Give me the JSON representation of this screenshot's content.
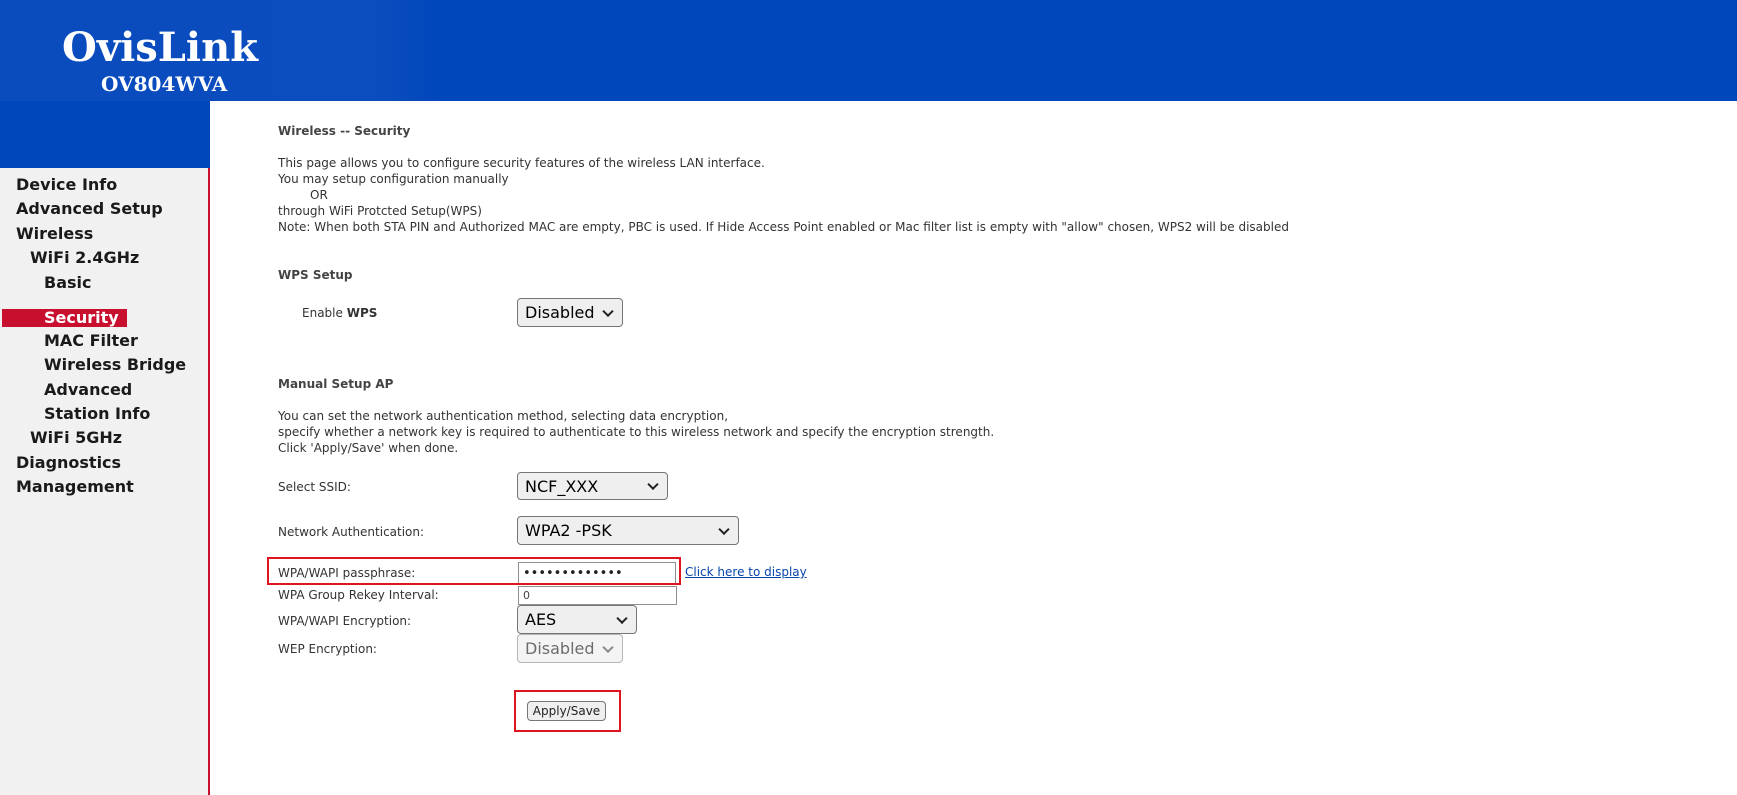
{
  "header": {
    "brand": "OvisLink",
    "model": "OV804WVA"
  },
  "colors": {
    "header_blue": "#0047bb",
    "active_red": "#c8102e",
    "highlight_red": "#e0141e",
    "link_blue": "#0645ad"
  },
  "sidebar": {
    "items": [
      {
        "label": "Device Info",
        "level": 0
      },
      {
        "label": "Advanced Setup",
        "level": 0
      },
      {
        "label": "Wireless",
        "level": 0
      },
      {
        "label": "WiFi 2.4GHz",
        "level": 1
      },
      {
        "label": "Basic",
        "level": 2
      },
      {
        "label": "Security",
        "level": 2,
        "active": true
      },
      {
        "label": "MAC Filter",
        "level": 2
      },
      {
        "label": "Wireless Bridge",
        "level": 2
      },
      {
        "label": "Advanced",
        "level": 2
      },
      {
        "label": "Station Info",
        "level": 2
      },
      {
        "label": "WiFi 5GHz",
        "level": 1
      },
      {
        "label": "Diagnostics",
        "level": 0
      },
      {
        "label": "Management",
        "level": 0
      }
    ]
  },
  "page": {
    "title": "Wireless -- Security",
    "intro": [
      "This page allows you to configure security features of the wireless LAN interface.",
      "You may setup configuration manually",
      "OR",
      "through WiFi Protcted Setup(WPS)",
      "Note: When both STA PIN and Authorized MAC are empty, PBC is used. If Hide Access Point enabled or Mac filter list is empty with \"allow\" chosen, WPS2 will be disabled"
    ]
  },
  "wps": {
    "title": "WPS Setup",
    "enable_label_prefix": "Enable ",
    "enable_label_bold": "WPS",
    "enable_value": "Disabled"
  },
  "manual": {
    "title": "Manual Setup AP",
    "desc": [
      "You can set the network authentication method, selecting data encryption,",
      "specify whether a network key is required to authenticate to this wireless network and specify the encryption strength.",
      "Click 'Apply/Save' when done."
    ],
    "ssid_label": "Select SSID:",
    "ssid_value": "NCF_XXX",
    "auth_label": "Network Authentication:",
    "auth_value": "WPA2 -PSK",
    "passphrase_label": "WPA/WAPI passphrase:",
    "passphrase_value": "•••••••••••••",
    "display_link": "Click here to display",
    "rekey_label": "WPA Group Rekey Interval:",
    "rekey_value": "0",
    "encryption_label": "WPA/WAPI Encryption:",
    "encryption_value": "AES",
    "wep_label": "WEP Encryption:",
    "wep_value": "Disabled",
    "apply_label": "Apply/Save"
  }
}
